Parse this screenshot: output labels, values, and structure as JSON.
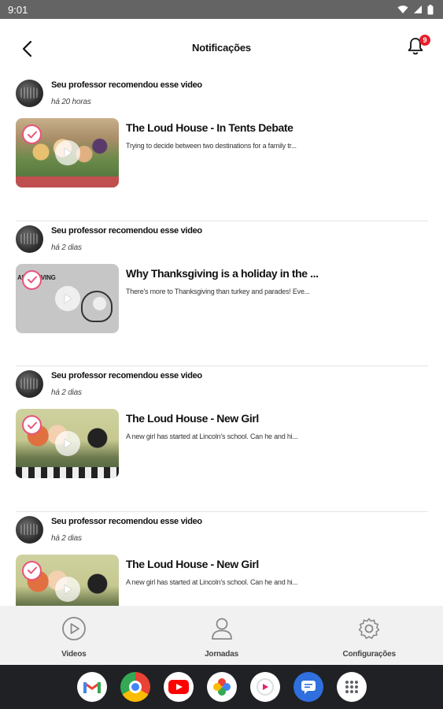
{
  "status_bar": {
    "time": "9:01"
  },
  "header": {
    "title": "Notificações",
    "notification_count": "9"
  },
  "notifications": [
    {
      "message": "Seu professor recomendou esse video",
      "time": "há 20 horas",
      "video_title": "The Loud House - In Tents Debate",
      "video_description": "Trying to decide between two destinations for a family tr..."
    },
    {
      "message": "Seu professor recomendou esse video",
      "time": "há 2 dias",
      "video_title": "Why Thanksgiving is a holiday in the ...",
      "video_description": "There's more to Thanksgiving than turkey and parades! Eve...",
      "thumb_text": "ANKSGIVING"
    },
    {
      "message": "Seu professor recomendou esse video",
      "time": "há 2 dias",
      "video_title": "The Loud House - New Girl",
      "video_description": "A new girl has started at Lincoln's school. Can he and hi..."
    },
    {
      "message": "Seu professor recomendou esse video",
      "time": "há 2 dias",
      "video_title": "The Loud House - New Girl",
      "video_description": "A new girl has started at Lincoln's school. Can he and hi..."
    }
  ],
  "bottom_nav": {
    "items": [
      {
        "label": "Videos",
        "icon": "play-circle-icon"
      },
      {
        "label": "Jornadas",
        "icon": "person-icon"
      },
      {
        "label": "Configurações",
        "icon": "gear-icon"
      }
    ]
  },
  "dock": {
    "apps": [
      "gmail-icon",
      "chrome-icon",
      "youtube-icon",
      "photos-icon",
      "video-app-icon",
      "messages-icon",
      "app-drawer-icon"
    ]
  },
  "colors": {
    "accent": "#e9547a",
    "badge": "#e5202e",
    "status_bar": "#646464",
    "dock": "#202124",
    "bottom_nav": "#f1f1f1"
  }
}
